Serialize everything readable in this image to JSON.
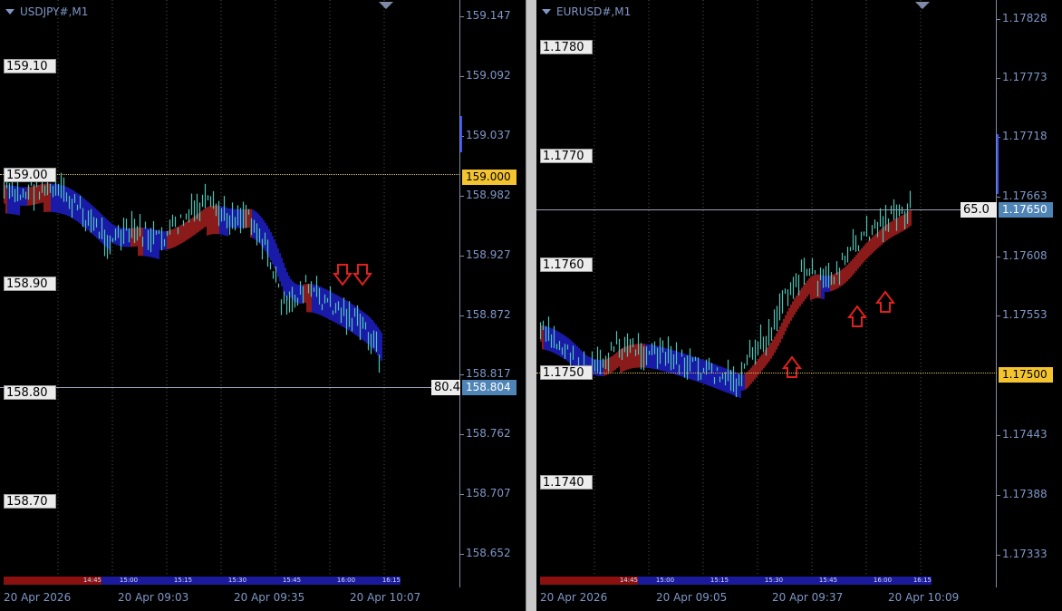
{
  "left": {
    "title": "USDJPY#,M1",
    "price_labels": [
      "159.10",
      "159.00",
      "158.90",
      "158.80",
      "158.70"
    ],
    "axis_ticks": [
      "159.147",
      "159.092",
      "159.037",
      "158.982",
      "158.927",
      "158.872",
      "158.817",
      "158.762",
      "158.707",
      "158.652"
    ],
    "alert_level": "159.000",
    "current_price": "158.804",
    "spread_value": "80.4",
    "time_labels": [
      "20 Apr 2026",
      "20 Apr 09:03",
      "20 Apr 09:35",
      "20 Apr 10:07"
    ],
    "session_labels": [
      "14:45",
      "15:00",
      "15:15",
      "15:30",
      "15:45",
      "16:00",
      "16:15"
    ]
  },
  "right": {
    "title": "EURUSD#,M1",
    "price_labels": [
      "1.1780",
      "1.1770",
      "1.1760",
      "1.1750",
      "1.1740"
    ],
    "axis_ticks": [
      "1.17828",
      "1.17773",
      "1.17718",
      "1.17663",
      "1.17608",
      "1.17553",
      "1.17498",
      "1.17443",
      "1.17388",
      "1.17333"
    ],
    "alert_level": "1.17500",
    "current_price": "1.17650",
    "spread_value": "65.0",
    "time_labels": [
      "20 Apr 2026",
      "20 Apr 09:05",
      "20 Apr 09:37",
      "20 Apr 10:09"
    ],
    "session_labels": [
      "14:45",
      "15:00",
      "15:15",
      "15:30",
      "15:45",
      "16:00",
      "16:15"
    ]
  },
  "colors": {
    "background": "#000000",
    "bull_ribbon": "#1a1aa8",
    "bear_ribbon": "#8b1a1a",
    "candle": "#4fc3b4",
    "arrow": "#e02020",
    "alert": "#f4c430",
    "current": "#4f84b6",
    "axis_text": "#7f97c7"
  }
}
